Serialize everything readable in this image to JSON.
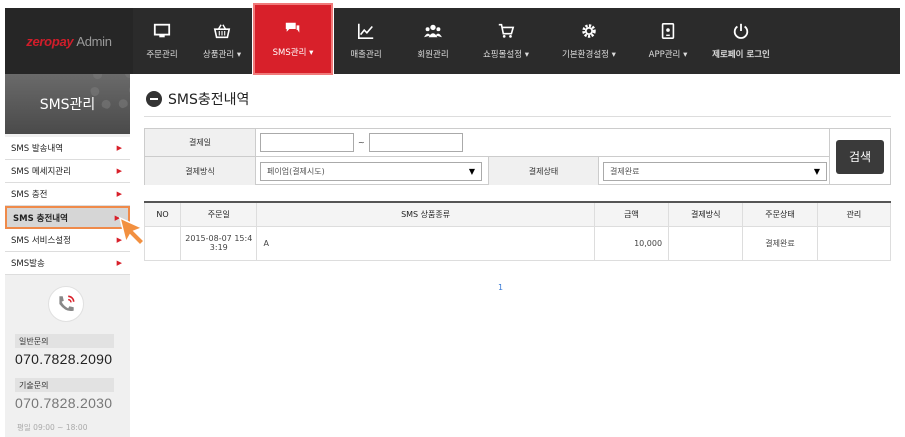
{
  "logo": {
    "brand": "zeropay",
    "suffix": "Admin"
  },
  "nav": [
    {
      "label": "주문관리",
      "icon": "monitor-icon"
    },
    {
      "label": "상품관리 ▾",
      "icon": "basket-icon"
    },
    {
      "label": "SMS관리 ▾",
      "icon": "chat-icon"
    },
    {
      "label": "매출관리",
      "icon": "chart-line-icon"
    },
    {
      "label": "회원관리",
      "icon": "users-icon"
    },
    {
      "label": "쇼핑몰설정 ▾",
      "icon": "cart-icon"
    },
    {
      "label": "기본환경설정 ▾",
      "icon": "gear-icon"
    },
    {
      "label": "APP관리 ▾",
      "icon": "tablet-icon"
    },
    {
      "label": "제로페이 로그인",
      "icon": "power-icon"
    }
  ],
  "sidebar": {
    "title": "SMS관리",
    "items": [
      {
        "label": "SMS 발송내역"
      },
      {
        "label": "SMS 메세지관리"
      },
      {
        "label": "SMS 충전"
      },
      {
        "label": "SMS 충전내역"
      },
      {
        "label": "SMS 서비스설정"
      },
      {
        "label": "SMS발송"
      }
    ],
    "contact": {
      "general_label": "일반문의",
      "general_number": "070.7828.2090",
      "tech_label": "기술문의",
      "tech_number": "070.7828.2030",
      "hours": "평일 09:00 ~ 18:00"
    }
  },
  "page": {
    "title": "SMS충전내역"
  },
  "search": {
    "date_label": "결제일",
    "date_from": "",
    "date_sep": "~",
    "date_to": "",
    "method_label": "결제방식",
    "method_value": "페이업(결제시도)",
    "status_label": "결제상태",
    "status_value": "결제완료",
    "button": "검색"
  },
  "table": {
    "headers": [
      "NO",
      "주문일",
      "SMS 상품종류",
      "금액",
      "결제방식",
      "주문상태",
      "관리"
    ],
    "rows": [
      {
        "no": "",
        "date": "2015-08-07 15:43:19",
        "product": "A",
        "amount": "10,000",
        "method": "",
        "status": "결제완료",
        "manage": ""
      }
    ]
  },
  "pagination": {
    "current": "1"
  },
  "colors": {
    "accent": "#d8202a",
    "topbar": "#2b2b2b",
    "highlight": "#ef8a4a"
  }
}
